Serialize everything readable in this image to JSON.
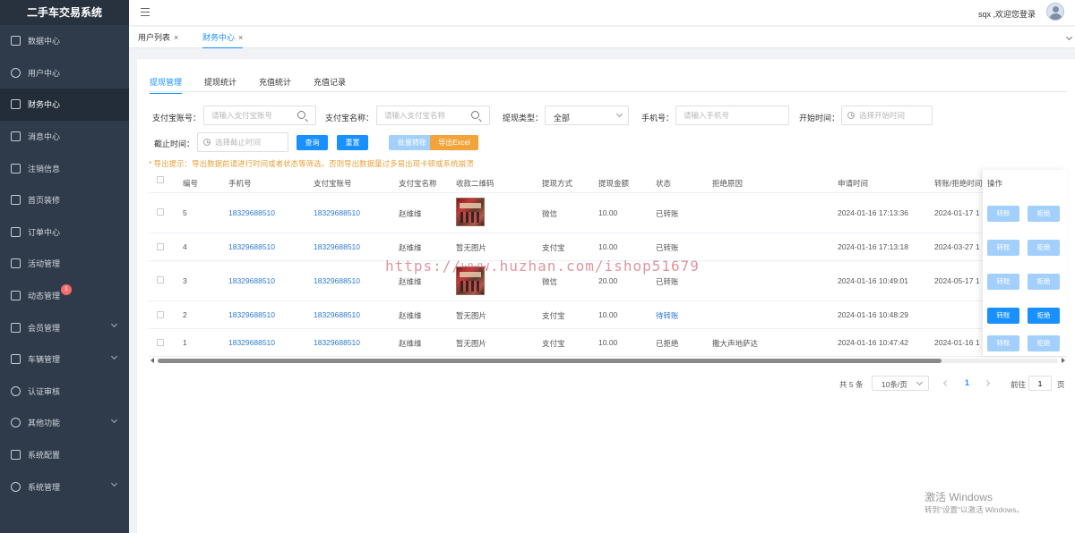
{
  "app": {
    "title": "二手车交易系统"
  },
  "sidebar": {
    "items": [
      {
        "label": "数据中心"
      },
      {
        "label": "用户中心"
      },
      {
        "label": "财务中心"
      },
      {
        "label": "消息中心"
      },
      {
        "label": "注销信息"
      },
      {
        "label": "首页装修"
      },
      {
        "label": "订单中心"
      },
      {
        "label": "活动管理"
      },
      {
        "label": "动态管理",
        "badge": "1"
      },
      {
        "label": "会员管理"
      },
      {
        "label": "车辆管理"
      },
      {
        "label": "认证审核"
      },
      {
        "label": "其他功能"
      },
      {
        "label": "系统配置"
      },
      {
        "label": "系统管理"
      }
    ]
  },
  "header": {
    "welcome": "sqx ,欢迎您登录"
  },
  "page_tabs": [
    {
      "label": "用户列表",
      "close": "×"
    },
    {
      "label": "财务中心",
      "close": "×"
    }
  ],
  "sub_tabs": [
    "提现管理",
    "提现统计",
    "充值统计",
    "充值记录"
  ],
  "filters": {
    "alipay_account_label": "支付宝账号：",
    "alipay_account_placeholder": "请输入支付宝账号",
    "alipay_name_label": "支付宝名称：",
    "alipay_name_placeholder": "请输入支付宝名称",
    "type_label": "提现类型：",
    "type_value": "全部",
    "phone_label": "手机号：",
    "phone_placeholder": "请输入手机号",
    "start_label": "开始时间：",
    "start_placeholder": "选择开始时间",
    "end_label": "截止时间：",
    "end_placeholder": "选择截止时间"
  },
  "buttons": {
    "query": "查询",
    "reset": "重置",
    "batch": "批量转账",
    "export": "导出Excel"
  },
  "notice": "* 导出提示：导出数据前请进行时间或者状态等筛选，否则导出数据量过多易出现卡顿或系统崩溃",
  "table": {
    "headers": [
      "编号",
      "手机号",
      "支付宝账号",
      "支付宝名称",
      "收款二维码",
      "提现方式",
      "提现金额",
      "状态",
      "拒绝原因",
      "申请时间",
      "转账/拒绝时间",
      "操作"
    ],
    "rows": [
      {
        "id": "5",
        "phone": "18329688510",
        "account": "18329688510",
        "name": "赵维维",
        "qr": "",
        "method": "微信",
        "amount": "10.00",
        "status": "已转账",
        "reason": "",
        "apply_time": "2024-01-16 17:13:36",
        "done_time": "2024-01-17 1",
        "btn_transfer": "转账",
        "btn_reject": "拒绝"
      },
      {
        "id": "4",
        "phone": "18329688510",
        "account": "18329688510",
        "name": "赵维维",
        "qr": "暂无图片",
        "method": "支付宝",
        "amount": "10.00",
        "status": "已转账",
        "reason": "",
        "apply_time": "2024-01-16 17:13:18",
        "done_time": "2024-03-27 1",
        "btn_transfer": "转账",
        "btn_reject": "拒绝"
      },
      {
        "id": "3",
        "phone": "18329688510",
        "account": "18329688510",
        "name": "赵维维",
        "qr": "",
        "method": "微信",
        "amount": "20.00",
        "status": "已转账",
        "reason": "",
        "apply_time": "2024-01-16 10:49:01",
        "done_time": "2024-05-17 1",
        "btn_transfer": "转账",
        "btn_reject": "拒绝"
      },
      {
        "id": "2",
        "phone": "18329688510",
        "account": "18329688510",
        "name": "赵维维",
        "qr": "暂无图片",
        "method": "支付宝",
        "amount": "10.00",
        "status": "待转账",
        "reason": "",
        "apply_time": "2024-01-16 10:48:29",
        "done_time": "",
        "btn_transfer": "转账",
        "btn_reject": "拒绝"
      },
      {
        "id": "1",
        "phone": "18329688510",
        "account": "18329688510",
        "name": "赵维维",
        "qr": "暂无图片",
        "method": "支付宝",
        "amount": "10.00",
        "status": "已拒绝",
        "reason": "撒大声地萨达",
        "apply_time": "2024-01-16 10:47:42",
        "done_time": "2024-01-16 1",
        "btn_transfer": "转账",
        "btn_reject": "拒绝"
      }
    ]
  },
  "pagination": {
    "total": "共 5 条",
    "page_size": "10条/页",
    "current": "1",
    "goto_label": "前往",
    "goto_value": "1",
    "goto_suffix": "页"
  },
  "watermark": "https://www.huzhan.com/ishop51679",
  "windows_activation": {
    "line1": "激活 Windows",
    "line2": "转到\"设置\"以激活 Windows。"
  },
  "colors": {
    "accent": "#1890ff",
    "sidebar_bg": "#2f3b4a",
    "warning": "#e6a23c",
    "export_button": "#f2a43a"
  }
}
